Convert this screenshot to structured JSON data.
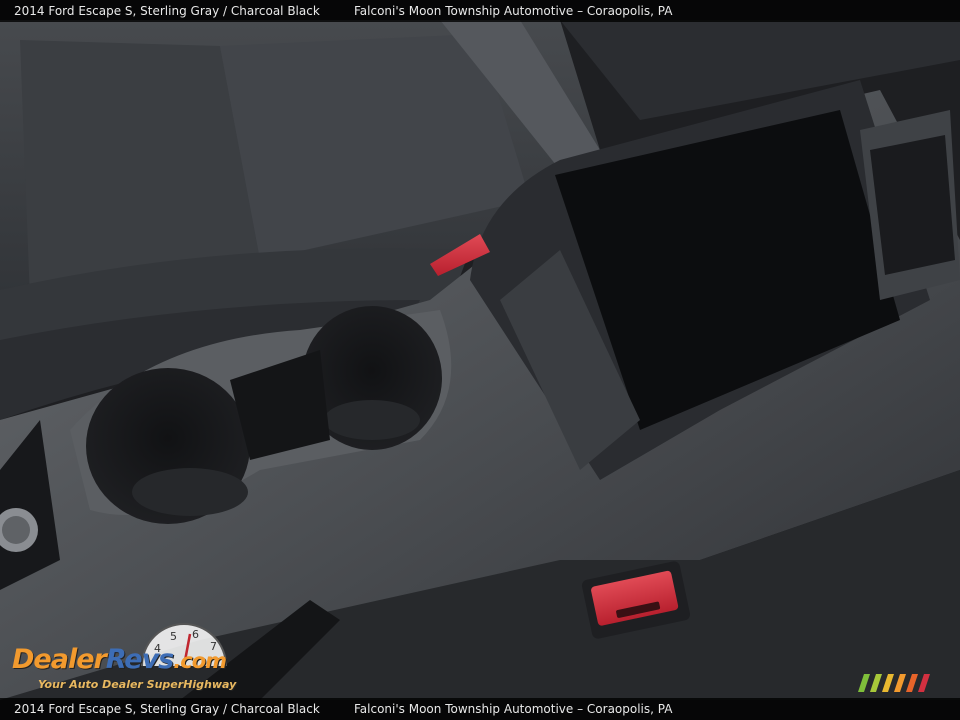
{
  "caption": {
    "vehicle": "2014 Ford Escape S,  Sterling Gray / Charcoal Black",
    "dealer": "Falconi's Moon Township Automotive – Coraopolis, PA"
  },
  "watermark": {
    "brand_dealer": "Dealer",
    "brand_revs": "Revs",
    "brand_tld": ".com",
    "tagline": "Your Auto Dealer SuperHighway",
    "gauge_digits": [
      "4",
      "5",
      "6",
      "7"
    ]
  },
  "colors": {
    "interior": "#2a2c2f",
    "trim": "#5c5f63",
    "seat_fabric": "#3a3d41",
    "buckle_red": "#d33040",
    "brand_orange": "#f29a2e",
    "brand_blue": "#3d6db5"
  },
  "icons": [
    "speedometer-gauge-icon",
    "stripes-logo-icon"
  ]
}
